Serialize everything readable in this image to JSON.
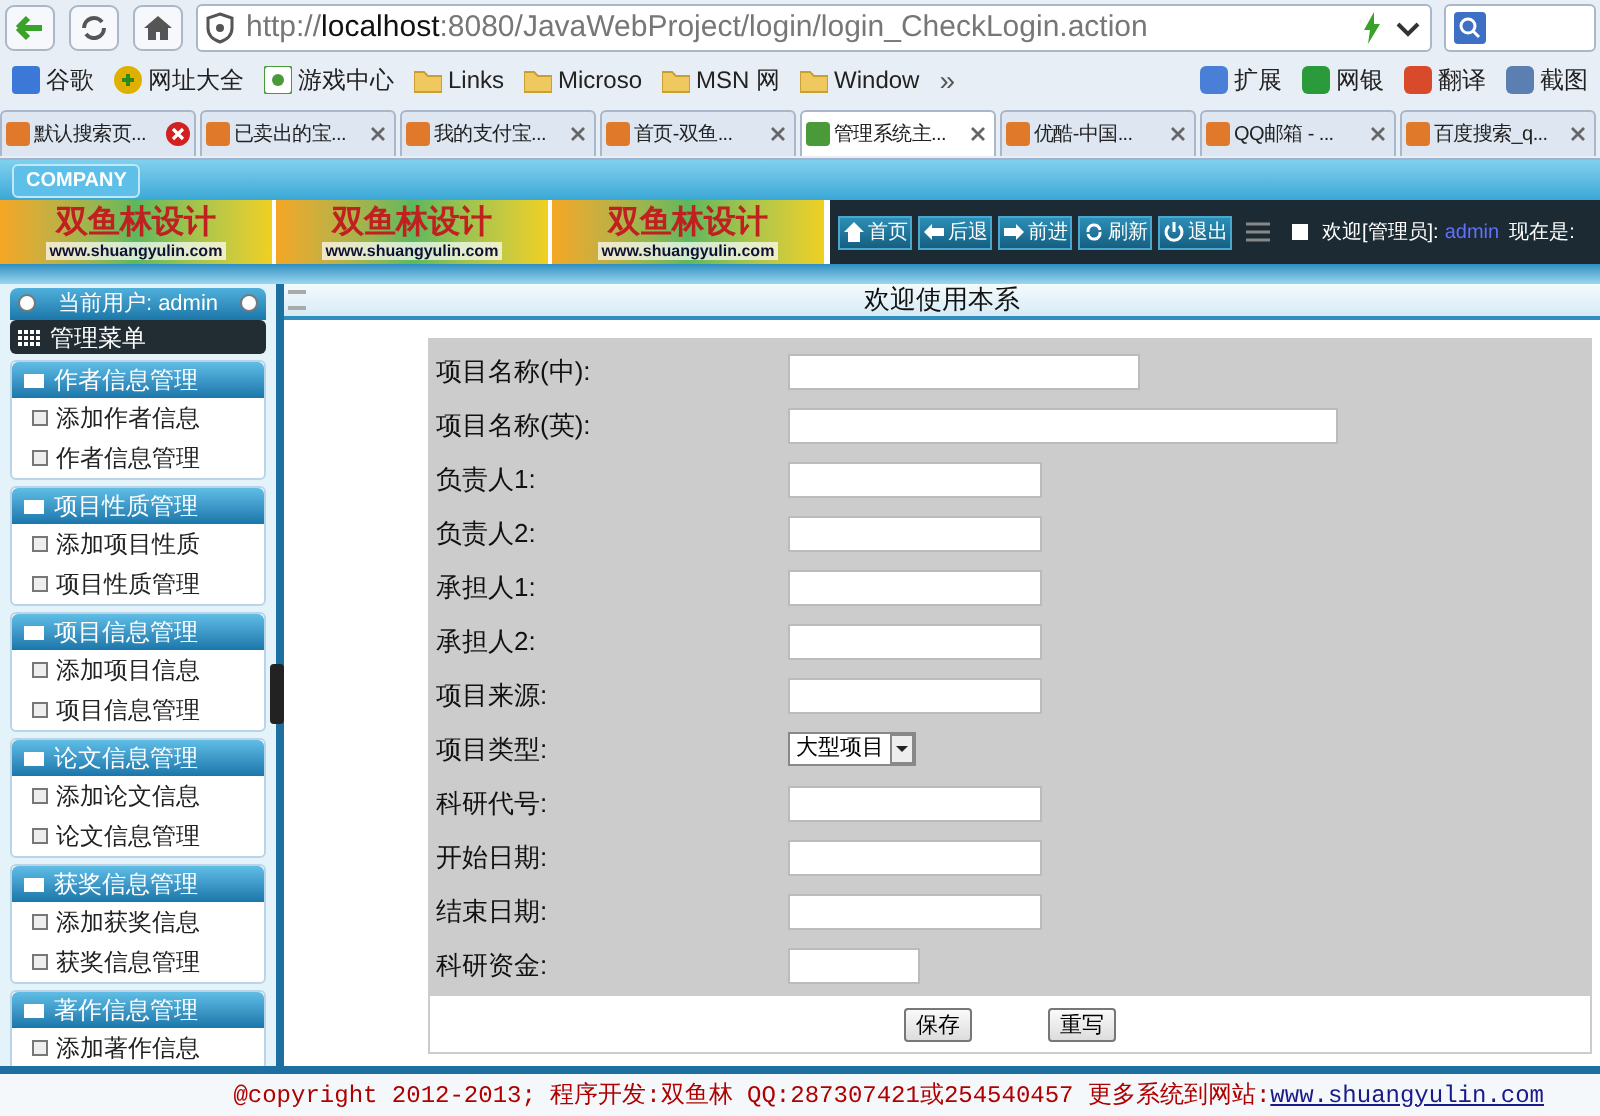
{
  "browser": {
    "url_prefix": "http://",
    "url_host": "localhost",
    "url_rest": ":8080/JavaWebProject/login/login_CheckLogin.action",
    "bookmarks": [
      "谷歌",
      "网址大全",
      "游戏中心",
      "Links",
      "Microso",
      "MSN 网",
      "Window"
    ],
    "bookmarks_more": "»",
    "toolbar_items": [
      "扩展",
      "网银",
      "翻译",
      "截图"
    ],
    "tabs": [
      {
        "label": "默认搜索页...",
        "selected": false,
        "alert": true
      },
      {
        "label": "已卖出的宝...",
        "selected": false,
        "alert": false
      },
      {
        "label": "我的支付宝...",
        "selected": false,
        "alert": false
      },
      {
        "label": "首页-双鱼...",
        "selected": false,
        "alert": false
      },
      {
        "label": "管理系统主...",
        "selected": true,
        "alert": false
      },
      {
        "label": "优酷-中国...",
        "selected": false,
        "alert": false
      },
      {
        "label": "QQ邮箱 - ...",
        "selected": false,
        "alert": false
      },
      {
        "label": "百度搜索_q...",
        "selected": false,
        "alert": false
      }
    ]
  },
  "header": {
    "company": "COMPANY",
    "logos": [
      {
        "name": "双鱼林设计",
        "url": "www.shuangyulin.com"
      },
      {
        "name": "双鱼林设计",
        "url": "www.shuangyulin.com"
      },
      {
        "name": "双鱼林设计",
        "url": "www.shuangyulin.com"
      }
    ],
    "nav_buttons": [
      "首页",
      "后退",
      "前进",
      "刷新",
      "退出"
    ],
    "welcome": "欢迎[管理员]:",
    "user": "admin",
    "now": "现在是:"
  },
  "sidebar": {
    "current_user": "当前用户: admin",
    "menu_title": "管理菜单",
    "groups": [
      {
        "title": "作者信息管理",
        "items": [
          "添加作者信息",
          "作者信息管理"
        ]
      },
      {
        "title": "项目性质管理",
        "items": [
          "添加项目性质",
          "项目性质管理"
        ]
      },
      {
        "title": "项目信息管理",
        "items": [
          "添加项目信息",
          "项目信息管理"
        ]
      },
      {
        "title": "论文信息管理",
        "items": [
          "添加论文信息",
          "论文信息管理"
        ]
      },
      {
        "title": "获奖信息管理",
        "items": [
          "添加获奖信息",
          "获奖信息管理"
        ]
      },
      {
        "title": "著作信息管理",
        "items": [
          "添加著作信息"
        ]
      }
    ]
  },
  "main": {
    "title": "欢迎使用本系",
    "form": [
      {
        "label": "项目名称(中):",
        "kind": "text"
      },
      {
        "label": "项目名称(英):",
        "kind": "text"
      },
      {
        "label": "负责人1:",
        "kind": "text"
      },
      {
        "label": "负责人2:",
        "kind": "text"
      },
      {
        "label": "承担人1:",
        "kind": "text"
      },
      {
        "label": "承担人2:",
        "kind": "text"
      },
      {
        "label": "项目来源:",
        "kind": "text"
      },
      {
        "label": "项目类型:",
        "kind": "select",
        "value": "大型项目"
      },
      {
        "label": "科研代号:",
        "kind": "text"
      },
      {
        "label": "开始日期:",
        "kind": "text"
      },
      {
        "label": "结束日期:",
        "kind": "text"
      },
      {
        "label": "科研资金:",
        "kind": "text"
      }
    ],
    "buttons": [
      "保存",
      "重写"
    ]
  },
  "footer": {
    "text": "@copyright 2012-2013; 程序开发:双鱼林  QQ:287307421或254540457  更多系统到网站:",
    "link": "www.shuangyulin.com"
  }
}
